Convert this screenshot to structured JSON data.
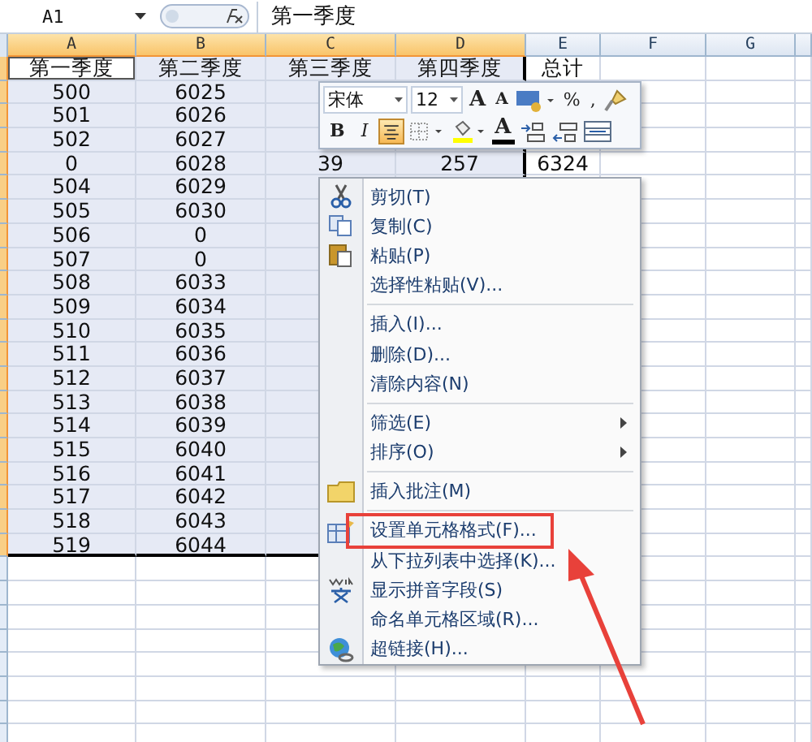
{
  "name_box": "A1",
  "formula_bar": {
    "value": "第一季度"
  },
  "columns": [
    {
      "label": "A",
      "selected": true
    },
    {
      "label": "B",
      "selected": true
    },
    {
      "label": "C",
      "selected": true
    },
    {
      "label": "D",
      "selected": true
    },
    {
      "label": "E",
      "selected": false
    },
    {
      "label": "F",
      "selected": false
    },
    {
      "label": "G",
      "selected": false
    }
  ],
  "rows": [
    {
      "selected": true,
      "active": true,
      "cells": [
        "第一季度",
        "第二季度",
        "第三季度",
        "第四季度",
        "总计"
      ]
    },
    {
      "selected": true,
      "active": false,
      "cells": [
        "500",
        "6025"
      ]
    },
    {
      "selected": true,
      "active": false,
      "cells": [
        "501",
        "6026"
      ]
    },
    {
      "selected": true,
      "active": false,
      "cells": [
        "502",
        "6027"
      ]
    },
    {
      "selected": true,
      "active": false,
      "cells": [
        "0",
        "6028",
        "39",
        "257",
        "6324"
      ]
    },
    {
      "selected": true,
      "active": false,
      "cells": [
        "504",
        "6029"
      ]
    },
    {
      "selected": true,
      "active": false,
      "cells": [
        "505",
        "6030"
      ]
    },
    {
      "selected": true,
      "active": false,
      "cells": [
        "506",
        "0"
      ]
    },
    {
      "selected": true,
      "active": false,
      "cells": [
        "507",
        "0"
      ]
    },
    {
      "selected": true,
      "active": false,
      "cells": [
        "508",
        "6033"
      ]
    },
    {
      "selected": true,
      "active": false,
      "cells": [
        "509",
        "6034"
      ]
    },
    {
      "selected": true,
      "active": false,
      "cells": [
        "510",
        "6035"
      ]
    },
    {
      "selected": true,
      "active": false,
      "cells": [
        "511",
        "6036"
      ]
    },
    {
      "selected": true,
      "active": false,
      "cells": [
        "512",
        "6037"
      ]
    },
    {
      "selected": true,
      "active": false,
      "cells": [
        "513",
        "6038"
      ]
    },
    {
      "selected": true,
      "active": false,
      "cells": [
        "514",
        "6039"
      ]
    },
    {
      "selected": true,
      "active": false,
      "cells": [
        "515",
        "6040"
      ]
    },
    {
      "selected": true,
      "active": false,
      "cells": [
        "516",
        "6041"
      ]
    },
    {
      "selected": true,
      "active": false,
      "cells": [
        "517",
        "6042"
      ]
    },
    {
      "selected": true,
      "active": false,
      "cells": [
        "518",
        "6043"
      ]
    },
    {
      "selected": true,
      "active": false,
      "cells": [
        "519",
        "6044"
      ]
    },
    {
      "selected": false,
      "active": false,
      "cells": []
    },
    {
      "selected": false,
      "active": false,
      "cells": []
    },
    {
      "selected": false,
      "active": false,
      "cells": []
    },
    {
      "selected": false,
      "active": false,
      "cells": []
    },
    {
      "selected": false,
      "active": false,
      "cells": []
    },
    {
      "selected": false,
      "active": false,
      "cells": []
    },
    {
      "selected": false,
      "active": false,
      "cells": []
    },
    {
      "selected": false,
      "active": false,
      "cells": []
    }
  ],
  "mini_toolbar": {
    "font": "宋体",
    "size": "12",
    "row1": [
      {
        "kind": "grow",
        "label": "A"
      },
      {
        "kind": "shrink",
        "label": "A"
      },
      {
        "kind": "accounting"
      },
      {
        "kind": "text",
        "label": "%"
      },
      {
        "kind": "text",
        "label": ","
      },
      {
        "kind": "painter"
      }
    ],
    "row2": [
      {
        "kind": "bold",
        "label": "B",
        "on": false
      },
      {
        "kind": "italic",
        "label": "I",
        "on": false
      },
      {
        "kind": "center",
        "on": true
      },
      {
        "kind": "borders"
      },
      {
        "kind": "fill"
      },
      {
        "kind": "fontcolor",
        "label": "A"
      },
      {
        "kind": "incdec"
      },
      {
        "kind": "decdec"
      },
      {
        "kind": "merge"
      }
    ]
  },
  "context_menu": [
    {
      "kind": "cut",
      "label": "剪切(T)",
      "marked": false
    },
    {
      "kind": "copy",
      "label": "复制(C)",
      "marked": false
    },
    {
      "kind": "paste",
      "label": "粘贴(P)",
      "marked": false
    },
    {
      "kind": "plain",
      "label": "选择性粘贴(V)...",
      "marked": false
    },
    {
      "kind": "separator"
    },
    {
      "kind": "plain",
      "label": "插入(I)...",
      "marked": false
    },
    {
      "kind": "plain",
      "label": "删除(D)...",
      "marked": false
    },
    {
      "kind": "plain",
      "label": "清除内容(N)",
      "marked": false
    },
    {
      "kind": "separator"
    },
    {
      "kind": "submenu",
      "label": "筛选(E)",
      "marked": false
    },
    {
      "kind": "submenu",
      "label": "排序(O)",
      "marked": false
    },
    {
      "kind": "separator"
    },
    {
      "kind": "comment",
      "label": "插入批注(M)",
      "marked": false
    },
    {
      "kind": "separator"
    },
    {
      "kind": "format",
      "label": "设置单元格格式(F)...",
      "marked": true
    },
    {
      "kind": "plain",
      "label": "从下拉列表中选择(K)...",
      "marked": false
    },
    {
      "kind": "phonetic",
      "label": "显示拼音字段(S)",
      "marked": false
    },
    {
      "kind": "plain",
      "label": "命名单元格区域(R)...",
      "marked": false
    },
    {
      "kind": "link",
      "label": "超链接(H)...",
      "marked": false
    }
  ]
}
